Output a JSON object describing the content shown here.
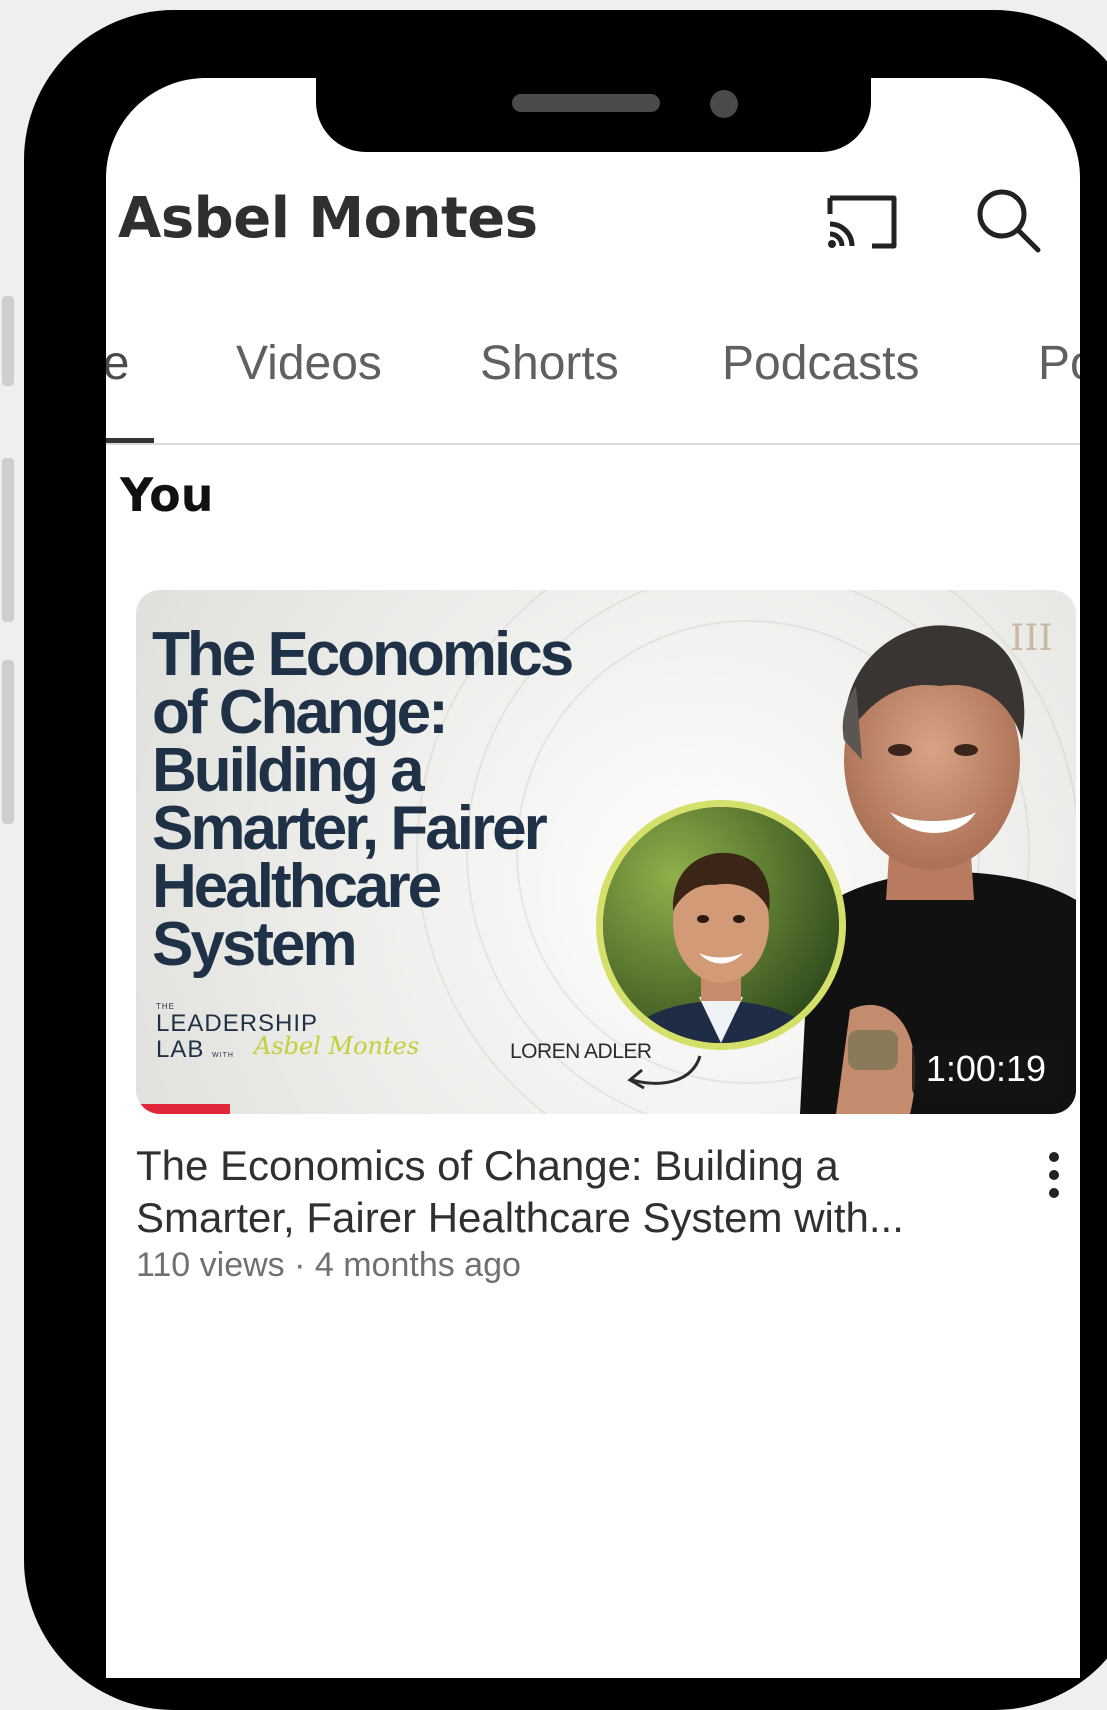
{
  "header": {
    "channel_name": "Asbel Montes",
    "cast_icon": "cast-icon",
    "search_icon": "search-icon"
  },
  "tabs": [
    {
      "label": "Home",
      "visible_text": "ne",
      "active": true
    },
    {
      "label": "Videos",
      "visible_text": "Videos",
      "active": false
    },
    {
      "label": "Shorts",
      "visible_text": "Shorts",
      "active": false
    },
    {
      "label": "Podcasts",
      "visible_text": "Podcasts",
      "active": false
    },
    {
      "label": "Posts",
      "visible_text": "Po",
      "active": false
    }
  ],
  "section": {
    "heading": "You"
  },
  "video": {
    "thumbnail": {
      "title_lines": [
        "The Economics",
        "of Change:",
        "Building a",
        "Smarter, Fairer",
        "Healthcare",
        "System"
      ],
      "brand_the": "THE",
      "brand_line1": "LEADERSHIP",
      "brand_line2": "LAB",
      "brand_with": "WITH",
      "brand_script": "Asbel Montes",
      "guest_name": "LOREN ADLER",
      "duration": "1:00:19",
      "watch_progress": 0.1
    },
    "title": "The Economics of Change: Building a Smarter, Fairer Healthcare System with...",
    "meta": "110 views · 4 months ago",
    "more_icon": "more-vertical-icon"
  },
  "colors": {
    "thumbnail_title": "#1f3147",
    "accent_progress": "#e0283a",
    "guest_ring": "#d4e06a",
    "phone_frame": "#000000"
  }
}
